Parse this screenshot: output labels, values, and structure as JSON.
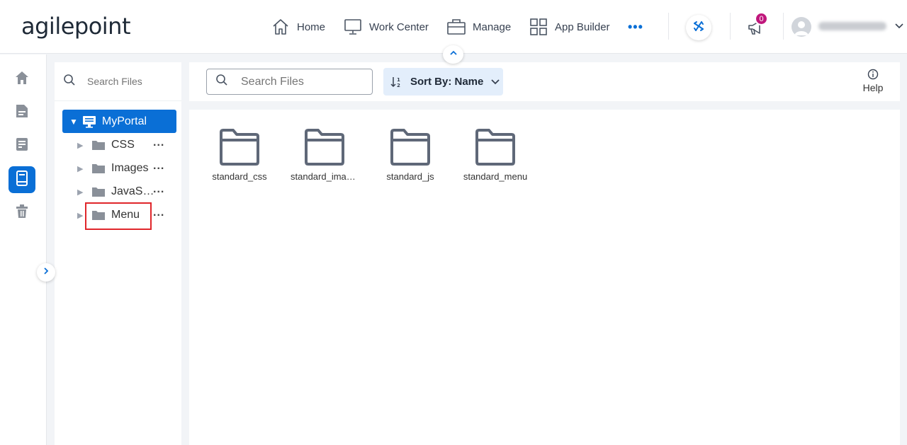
{
  "brand": {
    "logo_text": "agilepoint"
  },
  "nav": {
    "home": "Home",
    "work_center": "Work Center",
    "manage": "Manage",
    "app_builder": "App Builder",
    "more": "•••"
  },
  "notifications": {
    "count": "0"
  },
  "user": {
    "name": ""
  },
  "tree": {
    "search_placeholder": "Search Files",
    "root": "MyPortal",
    "items": [
      {
        "label": "CSS",
        "more": "..."
      },
      {
        "label": "Images",
        "more": "..."
      },
      {
        "label": "JavaScript",
        "more": "..."
      },
      {
        "label": "Menu",
        "more": "..."
      }
    ]
  },
  "toolbar": {
    "search_placeholder": "Search Files",
    "sort_label": "Sort By: Name",
    "help_label": "Help"
  },
  "files": [
    {
      "name": "standard_css"
    },
    {
      "name": "standard_images"
    },
    {
      "name": "standard_js"
    },
    {
      "name": "standard_menu"
    }
  ],
  "colors": {
    "accent": "#0a6fd6",
    "badge": "#c0177c",
    "highlight": "#e0262b"
  }
}
